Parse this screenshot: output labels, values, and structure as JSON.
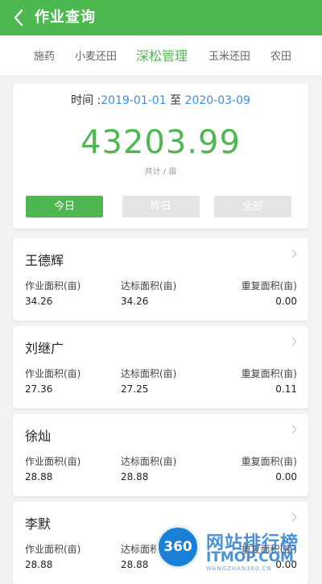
{
  "header": {
    "title": "作业查询"
  },
  "tabs": [
    {
      "label": "施药",
      "active": false
    },
    {
      "label": "小麦还田",
      "active": false
    },
    {
      "label": "深松管理",
      "active": true
    },
    {
      "label": "玉米还田",
      "active": false
    },
    {
      "label": "农田",
      "active": false
    }
  ],
  "summary": {
    "time_label": "时间 :",
    "start_date": "2019-01-01",
    "range_sep": " 至 ",
    "end_date": "2020-03-09",
    "total": "43203.99",
    "unit": "共计 / 亩",
    "filters": [
      {
        "label": "今日",
        "active": true
      },
      {
        "label": "昨日",
        "active": false
      },
      {
        "label": "全部",
        "active": false
      }
    ]
  },
  "field_labels": {
    "work_area": "作业面积(亩)",
    "standard_area": "达标面积(亩)",
    "repeat_area": "重复面积(亩)"
  },
  "records": [
    {
      "name": "王德辉",
      "work_area": "34.26",
      "standard_area": "34.26",
      "repeat_area": "0.00"
    },
    {
      "name": "刘继广",
      "work_area": "27.36",
      "standard_area": "27.25",
      "repeat_area": "0.11"
    },
    {
      "name": "徐灿",
      "work_area": "28.88",
      "standard_area": "28.88",
      "repeat_area": "0.00"
    },
    {
      "name": "李默",
      "work_area": "28.88",
      "standard_area": "28.88",
      "repeat_area": "0.00"
    }
  ],
  "watermark": {
    "logo": "360",
    "line1": "网站排行榜",
    "line2": "ITMOP.COM",
    "line3": "WANGZHAN360.CN"
  },
  "colors": {
    "accent": "#4cb84f",
    "date_blue": "#3a8ee6",
    "inactive_button": "#e4e4e4"
  }
}
